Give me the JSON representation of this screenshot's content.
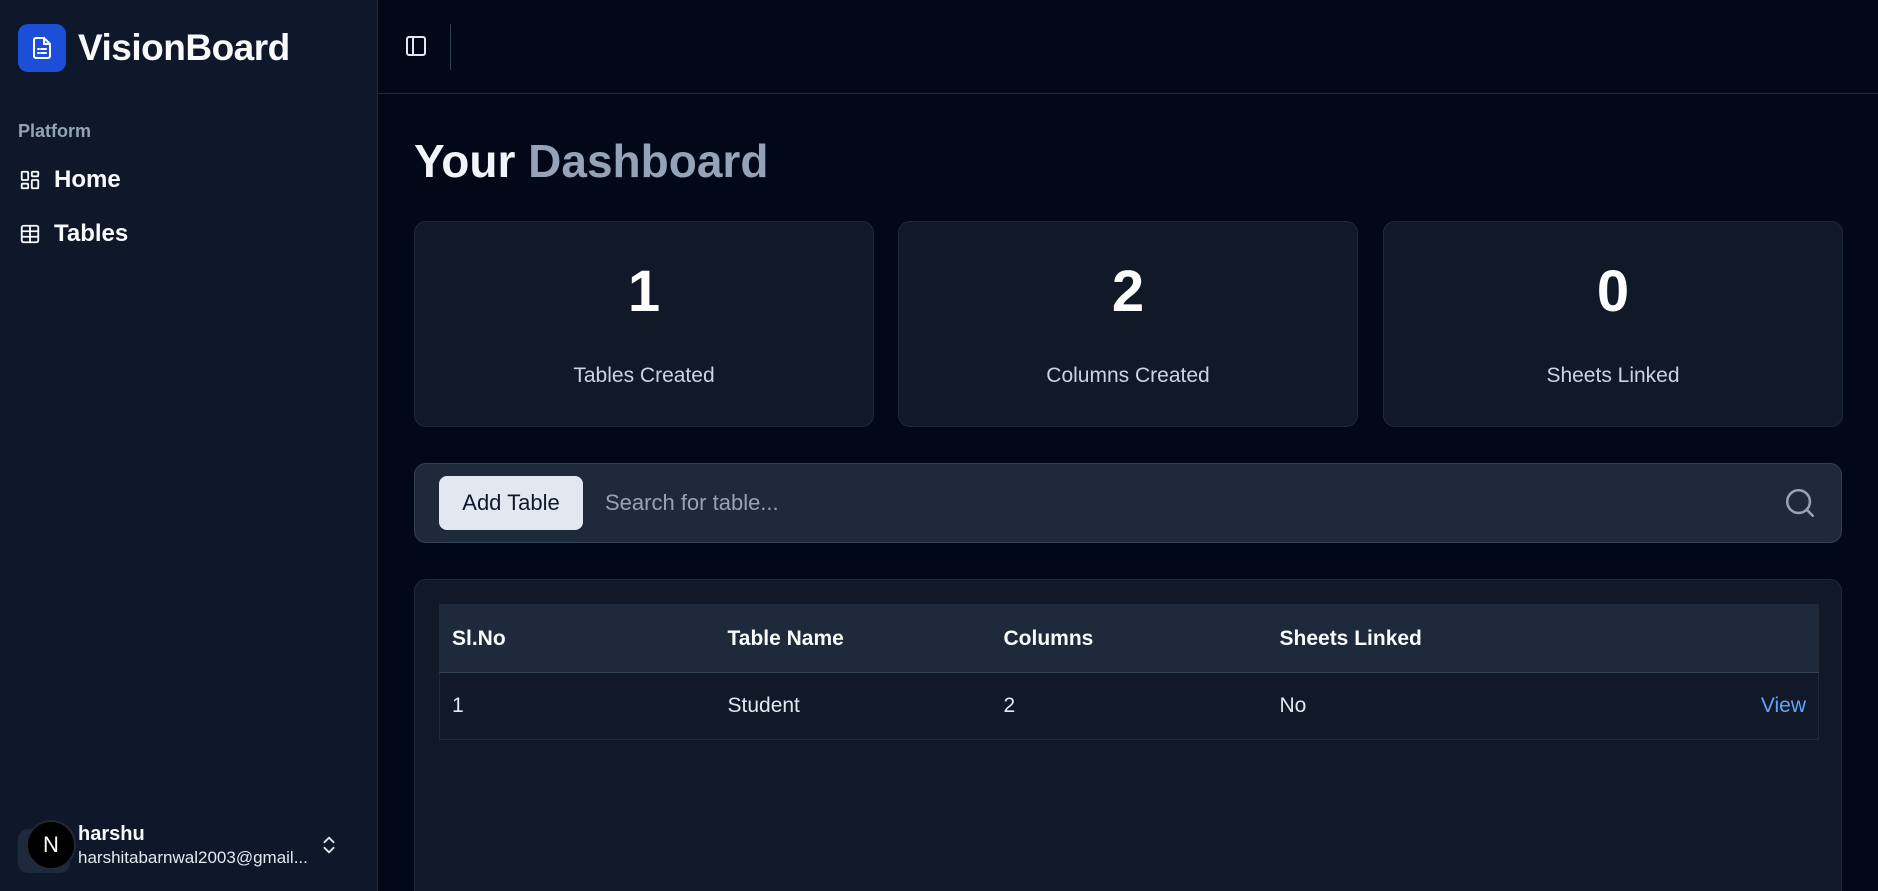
{
  "brand": {
    "name": "VisionBoard",
    "accent": "#1d4ed8"
  },
  "sidebar": {
    "group_label": "Platform",
    "items": [
      {
        "label": "Home",
        "icon": "dashboard-grid-icon"
      },
      {
        "label": "Tables",
        "icon": "table-icon"
      }
    ],
    "user": {
      "name": "harshu",
      "email": "harshitabarnwal2003@gmail...",
      "avatar_initial": "N"
    }
  },
  "page": {
    "title_part1": "Your",
    "title_part2": "Dashboard"
  },
  "stats": [
    {
      "value": "1",
      "label": "Tables Created"
    },
    {
      "value": "2",
      "label": "Columns Created"
    },
    {
      "value": "0",
      "label": "Sheets Linked"
    }
  ],
  "toolbar": {
    "add_label": "Add Table",
    "search_placeholder": "Search for table..."
  },
  "table": {
    "headers": [
      "Sl.No",
      "Table Name",
      "Columns",
      "Sheets Linked",
      ""
    ],
    "rows": [
      {
        "slno": "1",
        "name": "Student",
        "columns": "2",
        "sheets": "No",
        "action": "View"
      }
    ]
  }
}
